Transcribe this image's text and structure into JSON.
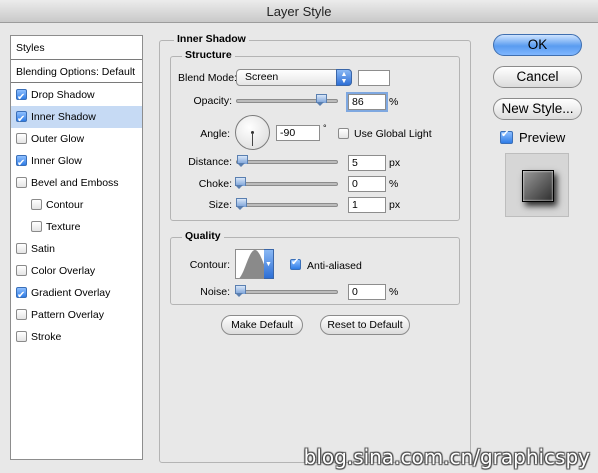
{
  "window": {
    "title": "Layer Style"
  },
  "styles_list": {
    "items": [
      {
        "label": "Styles",
        "type": "header"
      },
      {
        "label": "Blending Options: Default",
        "type": "header"
      },
      {
        "label": "Drop Shadow",
        "checked": true
      },
      {
        "label": "Inner Shadow",
        "checked": true,
        "selected": true
      },
      {
        "label": "Outer Glow",
        "checked": false
      },
      {
        "label": "Inner Glow",
        "checked": true
      },
      {
        "label": "Bevel and Emboss",
        "checked": false
      },
      {
        "label": "Contour",
        "checked": false,
        "indent": true
      },
      {
        "label": "Texture",
        "checked": false,
        "indent": true
      },
      {
        "label": "Satin",
        "checked": false
      },
      {
        "label": "Color Overlay",
        "checked": false
      },
      {
        "label": "Gradient Overlay",
        "checked": true
      },
      {
        "label": "Pattern Overlay",
        "checked": false
      },
      {
        "label": "Stroke",
        "checked": false
      }
    ]
  },
  "inner_shadow": {
    "section_title": "Inner Shadow",
    "structure": {
      "title": "Structure",
      "blend_mode_label": "Blend Mode:",
      "blend_mode_value": "Screen",
      "blend_color": "#ffffff",
      "opacity_label": "Opacity:",
      "opacity_value": "86",
      "opacity_unit": "%",
      "opacity_level": 0.86,
      "angle_label": "Angle:",
      "angle_value": "-90",
      "angle_unit": "°",
      "global_light_label": "Use Global Light",
      "global_light_checked": false,
      "distance_label": "Distance:",
      "distance_value": "5",
      "distance_unit": "px",
      "choke_label": "Choke:",
      "choke_value": "0",
      "choke_unit": "%",
      "size_label": "Size:",
      "size_value": "1",
      "size_unit": "px"
    },
    "quality": {
      "title": "Quality",
      "contour_label": "Contour:",
      "antialiased_label": "Anti-aliased",
      "antialiased_checked": true,
      "noise_label": "Noise:",
      "noise_value": "0",
      "noise_unit": "%"
    },
    "make_default_label": "Make Default",
    "reset_default_label": "Reset to Default"
  },
  "actions": {
    "ok_label": "OK",
    "cancel_label": "Cancel",
    "new_style_label": "New Style...",
    "preview_label": "Preview",
    "preview_checked": true
  },
  "watermark": "blog.sina.com.cn/graphicspy",
  "colors": {
    "accent": "#2f7ce6",
    "selection": "#c6daf4"
  }
}
